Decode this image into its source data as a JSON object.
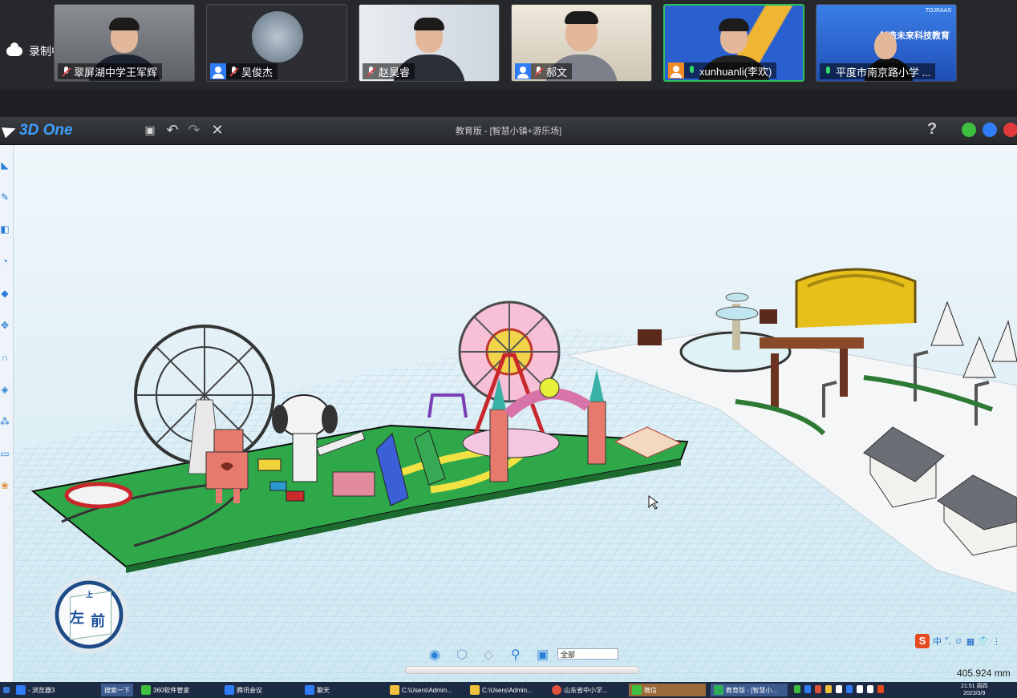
{
  "meeting": {
    "recording_label": "录制中",
    "participants": [
      {
        "name": "翠屏湖中学王军辉",
        "mic": "off",
        "badge": "none",
        "bg": "#6c6f74"
      },
      {
        "name": "吴俊杰",
        "mic": "off",
        "badge": "host",
        "bg": "#2c2e33"
      },
      {
        "name": "赵昊睿",
        "mic": "off",
        "badge": "none",
        "bg": "#c9ced6"
      },
      {
        "name": "郝文",
        "mic": "off",
        "badge": "host",
        "bg": "#d9d2c4"
      },
      {
        "name": "xunhuanli(李欢)",
        "mic": "on",
        "badge": "orange",
        "bg": "#2a5fd0"
      },
      {
        "name": "平度市南京路小学 ...",
        "mic": "on",
        "badge": "none",
        "bg": "#2b64c9"
      }
    ],
    "tile5_banner": "TOJRAAS",
    "tile5_banner_text": "创造未来科技教育"
  },
  "app": {
    "logo": "3D One",
    "document_title": "教育版 - [智慧小镇+游乐场]",
    "help_label": "?",
    "toolbar_icons": [
      "save-icon",
      "undo-icon",
      "redo-icon",
      "close-icon"
    ],
    "window_controls": {
      "minimize": "#3fbf3f",
      "restore": "#2f7cf6",
      "close": "#e03a3a"
    }
  },
  "left_tools": [
    "sketch-icon",
    "brush-icon",
    "shape-icon",
    "paint-icon",
    "solid-icon",
    "move-icon",
    "combine-icon",
    "component-icon",
    "material-icon",
    "measure-icon",
    "color-icon"
  ],
  "view_cube": {
    "left": "左",
    "front": "前",
    "top": "上"
  },
  "view_tools": {
    "icons": [
      "eye-icon",
      "cube-view-icon",
      "wireframe-icon",
      "zoom-icon",
      "fit-view-icon"
    ],
    "select_value": "全部"
  },
  "ime": {
    "logo": "S",
    "items": [
      "中",
      "°,",
      "☺",
      "▦",
      "👕",
      "⋮"
    ]
  },
  "measure_readout": "405.924 mm",
  "taskbar": {
    "items": [
      {
        "label": "- 浏览器3",
        "color": "#2f7cf6"
      },
      {
        "label": "搜索一下",
        "color": "#2f7cf6",
        "active": true
      },
      {
        "label": "360软件管家",
        "color": "#3fbf3f"
      },
      {
        "label": "腾讯会议",
        "color": "#2f7cf6"
      },
      {
        "label": "聊天",
        "color": "#2f7cf6"
      },
      {
        "label": "C:\\Users\\Admin...",
        "color": "#f0c23c"
      },
      {
        "label": "C:\\Users\\Admin...",
        "color": "#f0c23c"
      },
      {
        "label": "山东省中小学...",
        "color": "#e0523a"
      },
      {
        "label": "微信",
        "color": "#3fbf3f"
      },
      {
        "label": "教育版 - [智慧小...",
        "color": "#2fae5a"
      }
    ],
    "clock_time": "21:51 周四",
    "clock_date": "2023/3/9"
  }
}
